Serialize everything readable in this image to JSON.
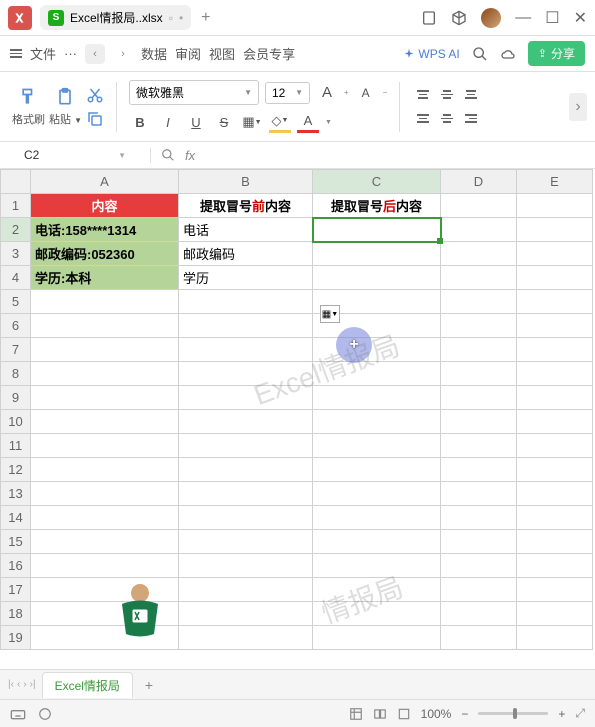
{
  "titlebar": {
    "file_name": "Excel情报局..xlsx",
    "add_tab": "+"
  },
  "menubar": {
    "file": "文件",
    "more": "···",
    "items": [
      "数据",
      "审阅",
      "视图",
      "会员专享"
    ],
    "ai": "WPS AI",
    "share": "分享"
  },
  "toolbar": {
    "format_painter": "格式刷",
    "paste": "粘贴",
    "font_name": "微软雅黑",
    "font_size": "12",
    "A_large": "A",
    "A_small": "A",
    "bold": "B",
    "italic": "I",
    "underline": "U",
    "strike": "S",
    "letter_A": "A"
  },
  "formula": {
    "name_box": "C2",
    "fx": "fx"
  },
  "columns": [
    "A",
    "B",
    "C",
    "D",
    "E"
  ],
  "rows": [
    "1",
    "2",
    "3",
    "4",
    "5",
    "6",
    "7",
    "8",
    "9",
    "10",
    "11",
    "12",
    "13",
    "14",
    "15",
    "16",
    "17",
    "18",
    "19"
  ],
  "active": {
    "col": 2,
    "row": 1
  },
  "cells": {
    "A1": "内容",
    "B1_pre": "提取冒号",
    "B1_mid": "前",
    "B1_post": "内容",
    "C1_pre": "提取冒号",
    "C1_mid": "后",
    "C1_post": "内容",
    "A2": "电话:158****1314",
    "B2": "电话",
    "A3": "邮政编码:052360",
    "B3": "邮政编码",
    "A4": "学历:本科",
    "B4": "学历"
  },
  "watermarks": {
    "w1": "Excel情报局",
    "w2": "情报局"
  },
  "sheet_tabs": {
    "tab1": "Excel情报局",
    "add": "+"
  },
  "statusbar": {
    "zoom": "100%",
    "minus": "−",
    "plus": "+"
  }
}
